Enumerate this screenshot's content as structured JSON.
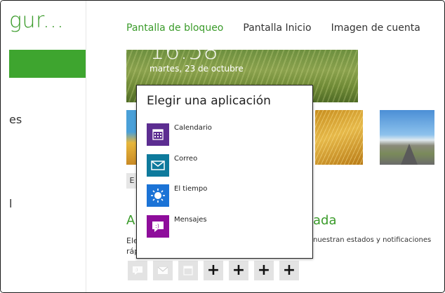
{
  "left_pane": {
    "title": "gur...",
    "item_1": "es",
    "item_2": "l"
  },
  "tabs": [
    {
      "label": "Pantalla de bloqueo",
      "active": true
    },
    {
      "label": "Pantalla Inicio",
      "active": false
    },
    {
      "label": "Imagen de cuenta",
      "active": false
    }
  ],
  "lock_preview": {
    "time": "16:58",
    "date": "martes, 23 de octubre"
  },
  "browse_button_label": "E",
  "section": {
    "heading_start": "A",
    "heading_end": "ada",
    "desc_line1_start": "Ele",
    "desc_line2_start": "ráp",
    "desc_line1_end": "nuestran estados y notificaciones"
  },
  "popup": {
    "title": "Elegir una aplicación",
    "apps": [
      {
        "name": "Calendario",
        "icon": "calendar-icon",
        "color": "#5c2d91"
      },
      {
        "name": "Correo",
        "icon": "mail-icon",
        "color": "#0e7a9c"
      },
      {
        "name": "El tiempo",
        "icon": "weather-sun-icon",
        "color": "#1b73d6"
      },
      {
        "name": "Mensajes",
        "icon": "messaging-icon",
        "color": "#8e0d9b"
      }
    ]
  },
  "slots": [
    {
      "type": "messaging-icon"
    },
    {
      "type": "mail-icon"
    },
    {
      "type": "calendar-icon"
    },
    {
      "type": "plus",
      "label": "+"
    },
    {
      "type": "plus",
      "label": "+"
    },
    {
      "type": "plus",
      "label": "+"
    },
    {
      "type": "plus",
      "label": "+"
    }
  ],
  "colors": {
    "accent_green": "#3a9b2a",
    "accent_bar": "#3ea52f"
  }
}
